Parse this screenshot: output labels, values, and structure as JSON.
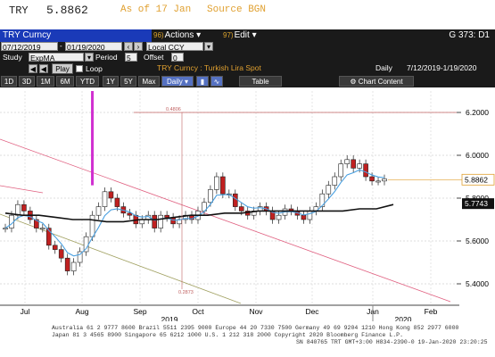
{
  "header": {
    "ticker": "TRY",
    "price": "5.8862",
    "as_of": "As of 17 Jan",
    "source": "Source BGN"
  },
  "toolbar": {
    "title": "TRY Curncy",
    "actions_num": "96)",
    "actions_label": "Actions ▾",
    "edit_num": "97)",
    "edit_label": "Edit ▾",
    "graph_id": "G 373: D1"
  },
  "controls": {
    "start_date": "07/12/2019",
    "end_date": "01/19/2020",
    "currency": "Local CCY",
    "study_label": "Study",
    "study_value": "ExpMA",
    "period_label": "Period",
    "period_value": "5",
    "offset_label": "Offset",
    "offset_value": "0",
    "play_label": "Play",
    "loop_label": "Loop",
    "chart_title": "TRY Curncy : Turkish Lira Spot",
    "frequency_label": "Daily",
    "date_range": "7/12/2019-1/19/2020"
  },
  "timeframe_buttons": [
    "1D",
    "3D",
    "1M",
    "6M",
    "YTD",
    "1Y",
    "5Y",
    "Max"
  ],
  "frequency_select": "Daily ▾",
  "table_button": "Table",
  "chart_content_button": "Chart Content",
  "chart_data": {
    "type": "candlestick",
    "title": "TRY Curncy : Turkish Lira Spot",
    "ylim": [
      5.3,
      6.3
    ],
    "yticks": [
      "6.2000",
      "6.0000",
      "5.8000",
      "5.6000",
      "5.4000"
    ],
    "ytick_values": [
      6.2,
      6.0,
      5.8,
      5.6,
      5.4
    ],
    "last_price_label": "5.8862",
    "last_price": 5.8862,
    "ma_label": "5.7743",
    "ma_value": 5.7743,
    "xaxis_months": [
      "Jul",
      "Aug",
      "Sep",
      "Oct",
      "Nov",
      "Dec",
      "Jan",
      "Feb"
    ],
    "xaxis_years": [
      "2019",
      "2020"
    ],
    "annotations": [
      "0.4806",
      "0.2873"
    ],
    "hline_value": 6.2,
    "series": [
      {
        "name": "price",
        "values": [
          5.66,
          5.72,
          5.77,
          5.74,
          5.7,
          5.66,
          5.66,
          5.58,
          5.56,
          5.52,
          5.46,
          5.5,
          5.55,
          5.62,
          5.72,
          5.76,
          5.83,
          5.8,
          5.76,
          5.73,
          5.72,
          5.68,
          5.7,
          5.72,
          5.66,
          5.72,
          5.71,
          5.68,
          5.7,
          5.72,
          5.7,
          5.74,
          5.78,
          5.84,
          5.9,
          5.82,
          5.82,
          5.76,
          5.74,
          5.72,
          5.74,
          5.76,
          5.74,
          5.7,
          5.72,
          5.75,
          5.74,
          5.72,
          5.7,
          5.74,
          5.76,
          5.82,
          5.86,
          5.9,
          5.96,
          5.98,
          5.94,
          5.96,
          5.9,
          5.88,
          5.88,
          5.89
        ]
      },
      {
        "name": "ma_long",
        "values": [
          5.73,
          5.72,
          5.72,
          5.71,
          5.7,
          5.7,
          5.69,
          5.69,
          5.7,
          5.7,
          5.71,
          5.72,
          5.72,
          5.73,
          5.73,
          5.74,
          5.74,
          5.74,
          5.74,
          5.74,
          5.74,
          5.75,
          5.75,
          5.77
        ]
      }
    ]
  },
  "footer": {
    "line1": "Australia 61 2 9777 8600  Brazil 5511 2395 9000  Europe 44 20 7330 7500  Germany 49 69 9204 1210  Hong Kong 852 2977 6000",
    "line2": "Japan 81 3 4565 8900        Singapore 65 6212 1000        U.S. 1 212 318 2000        Copyright 2020 Bloomberg Finance L.P.",
    "line3": "SN 840765 TRT  GMT+3:00 H834-2390-0 19-Jan-2020 23:20:25"
  },
  "colors": {
    "accent": "#e0a030",
    "title_bar": "#1a3ab8",
    "ma_line": "#111111",
    "ema_line": "#4aa0e0",
    "last_price_box": "#ffffff",
    "channel": "#e06080",
    "spike": "#d030d0"
  }
}
